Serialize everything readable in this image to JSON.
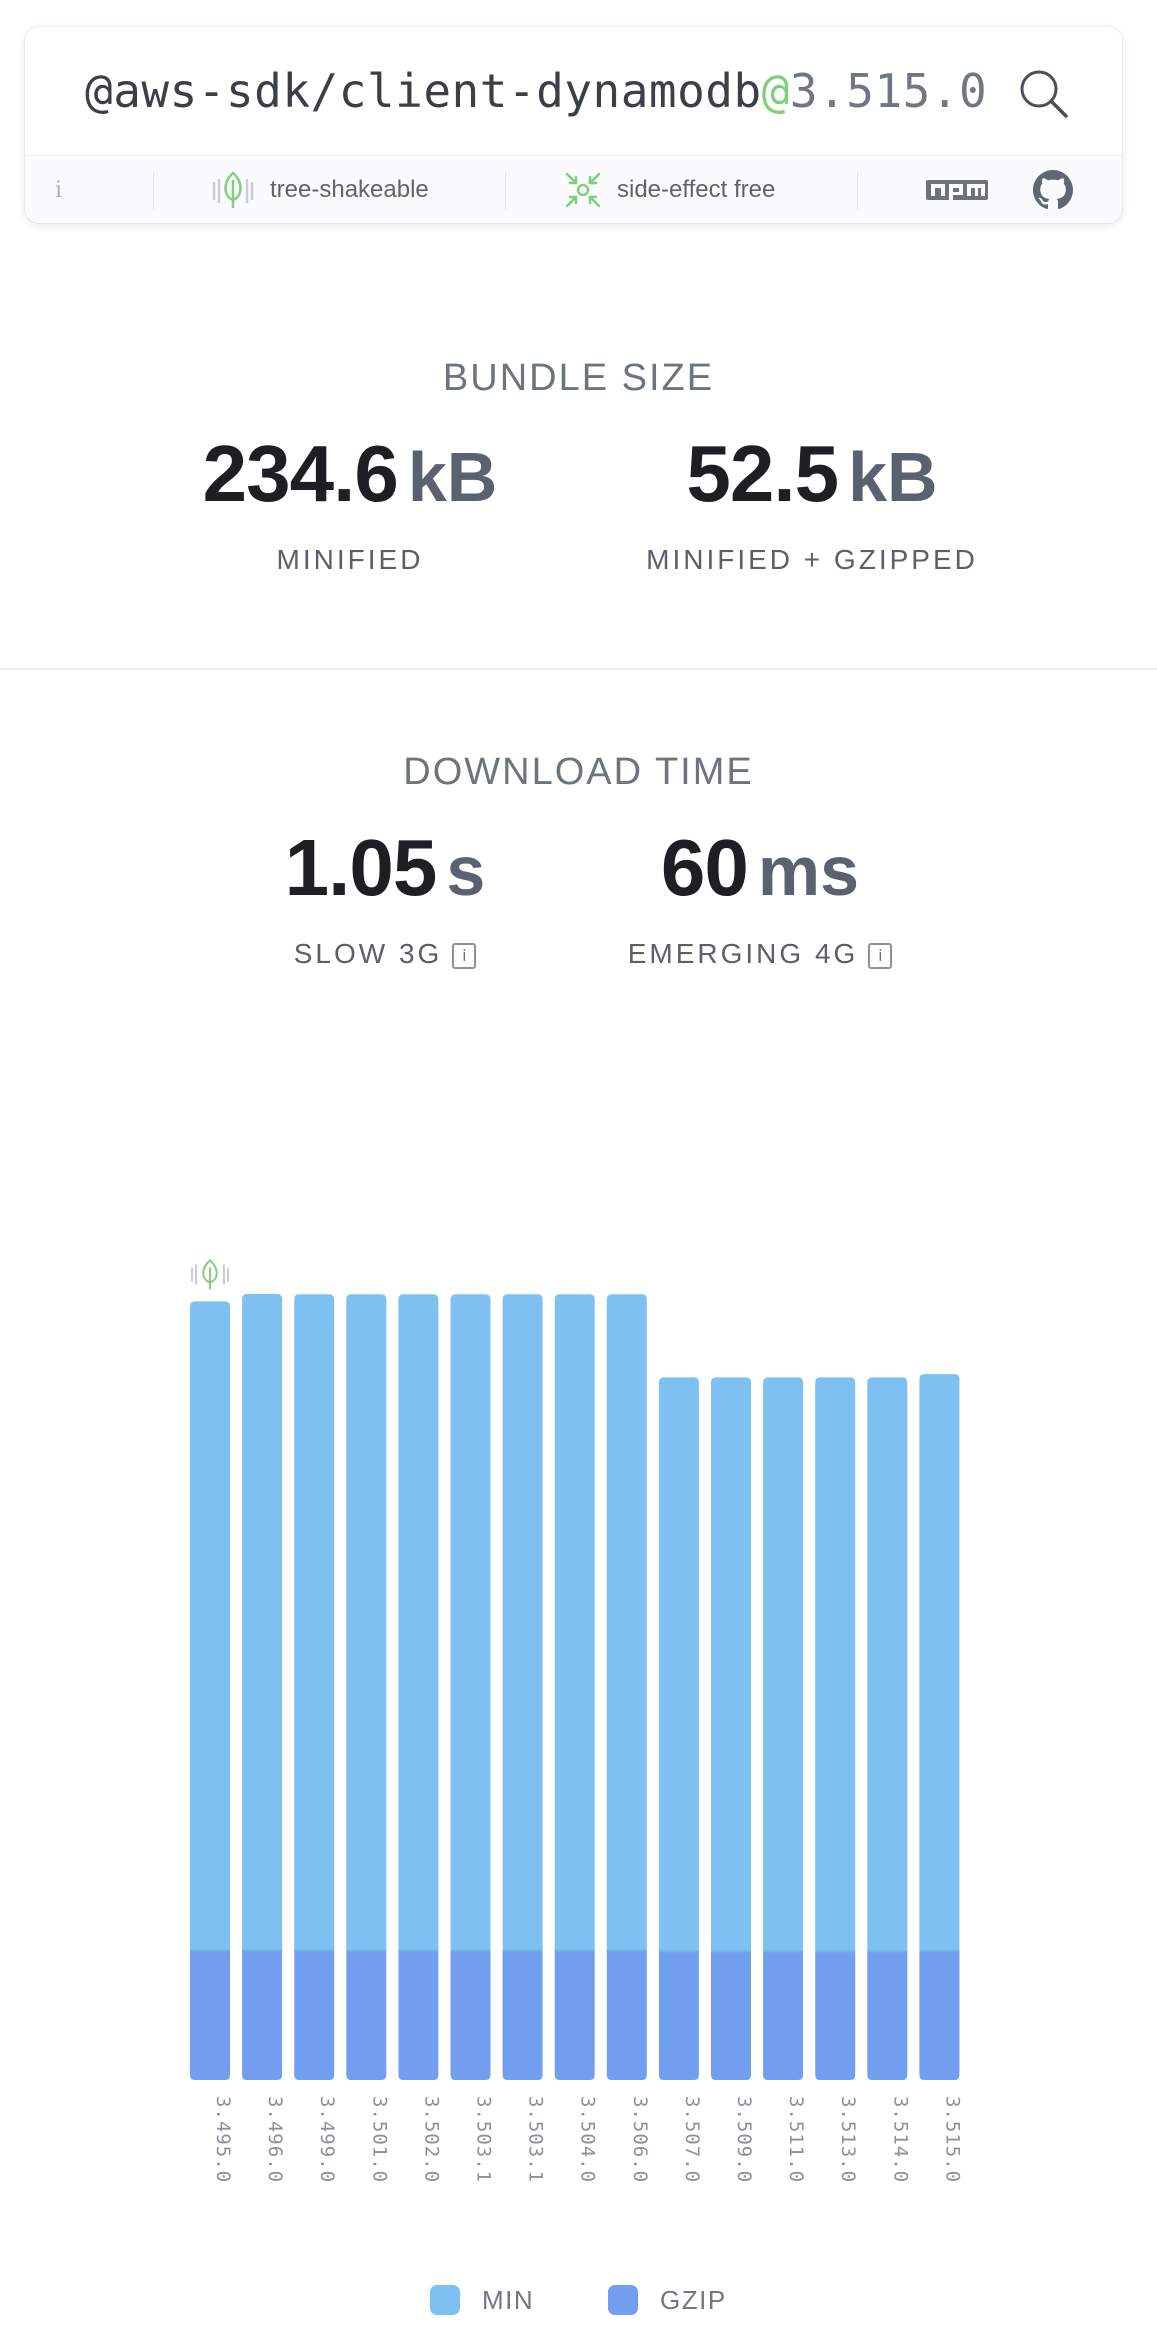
{
  "search": {
    "package_name": "@aws-sdk/client-dynamodb",
    "at_symbol": "@",
    "version": "3.515.0"
  },
  "badges": {
    "info": "i",
    "tree_shakeable": "tree-shakeable",
    "side_effect_free": "side-effect free",
    "npm_icon": "npm-icon",
    "github_icon": "github-icon"
  },
  "bundle_size": {
    "title": "BUNDLE SIZE",
    "minified": {
      "value": "234.6",
      "unit": "kB",
      "label": "MINIFIED"
    },
    "gzipped": {
      "value": "52.5",
      "unit": "kB",
      "label": "MINIFIED + GZIPPED"
    }
  },
  "download_time": {
    "title": "DOWNLOAD TIME",
    "slow3g": {
      "value": "1.05",
      "unit": "s",
      "label": "SLOW 3G",
      "info": "i"
    },
    "emerging4g": {
      "value": "60",
      "unit": "ms",
      "label": "EMERGING 4G",
      "info": "i"
    }
  },
  "colors": {
    "min": "#7ec0f1",
    "gzip": "#729ef0",
    "accent_green": "#7ed07b"
  },
  "chart_data": {
    "type": "bar",
    "stacked": true,
    "categories": [
      "3.495.0",
      "3.496.0",
      "3.499.0",
      "3.501.0",
      "3.502.0",
      "3.503.1",
      "3.503.1",
      "3.504.0",
      "3.506.0",
      "3.507.0",
      "3.509.0",
      "3.511.0",
      "3.513.0",
      "3.514.0",
      "3.515.0"
    ],
    "series": [
      {
        "name": "MIN",
        "values": [
          264.0,
          267.0,
          267.0,
          267.0,
          267.0,
          267.0,
          267.0,
          267.0,
          267.0,
          233.5,
          233.5,
          233.5,
          233.5,
          233.5,
          234.6
        ]
      },
      {
        "name": "GZIP",
        "values": [
          52.7,
          52.7,
          52.6,
          52.6,
          52.6,
          52.6,
          52.6,
          52.6,
          52.6,
          52.3,
          52.3,
          52.3,
          52.3,
          52.3,
          52.5
        ]
      }
    ],
    "tree_shakeable_marker_index": 0,
    "legend": [
      "MIN",
      "GZIP"
    ],
    "legend_position": "bottom"
  }
}
